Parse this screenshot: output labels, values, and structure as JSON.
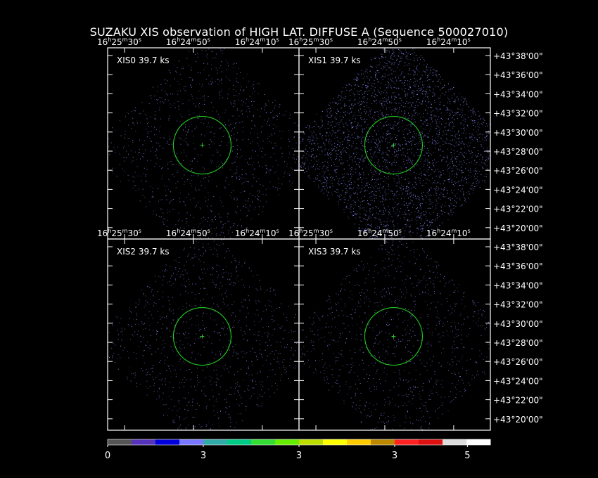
{
  "title": "SUZAKU XIS observation of HIGH LAT. DIFFUSE A  (Sequence 500027010)",
  "colors": {
    "background": "#000000",
    "frame": "#ffffff",
    "region": "#22cc22",
    "photons": "#8c8cff"
  },
  "panels": [
    {
      "id": "xis0",
      "label": "XIS0  39.7 ks",
      "field": "diamond-faint",
      "show_ra_labels": true,
      "show_dec_labels": false
    },
    {
      "id": "xis1",
      "label": "XIS1  39.7 ks",
      "field": "diamond-bright",
      "show_ra_labels": true,
      "show_dec_labels": true
    },
    {
      "id": "xis2",
      "label": "XIS2  39.7 ks",
      "field": "diamond-faint",
      "show_ra_labels": true,
      "show_dec_labels": false
    },
    {
      "id": "xis3",
      "label": "XIS3  39.7 ks",
      "field": "diamond-faint",
      "show_ra_labels": true,
      "show_dec_labels": true
    }
  ],
  "ra_tick_labels": [
    {
      "h": "16",
      "m": "25",
      "s": "30"
    },
    {
      "h": "16",
      "m": "24",
      "s": "50"
    },
    {
      "h": "16",
      "m": "24",
      "s": "10"
    }
  ],
  "dec_tick_labels": [
    "+43°38'00\"",
    "+43°36'00\"",
    "+43°34'00\"",
    "+43°32'00\"",
    "+43°30'00\"",
    "+43°28'00\"",
    "+43°26'00\"",
    "+43°24'00\"",
    "+43°22'00\"",
    "+43°20'00\""
  ],
  "colorbar": {
    "tick_labels": [
      "0",
      "3",
      "3",
      "3",
      "5"
    ],
    "colors": [
      "#555555",
      "#5533bb",
      "#0000dd",
      "#7777ff",
      "#33aaaa",
      "#00cc88",
      "#33dd33",
      "#66ee00",
      "#bbdd00",
      "#ffff00",
      "#ffcc00",
      "#bb8800",
      "#ff2222",
      "#dd1111",
      "#dddddd",
      "#ffffff"
    ]
  }
}
